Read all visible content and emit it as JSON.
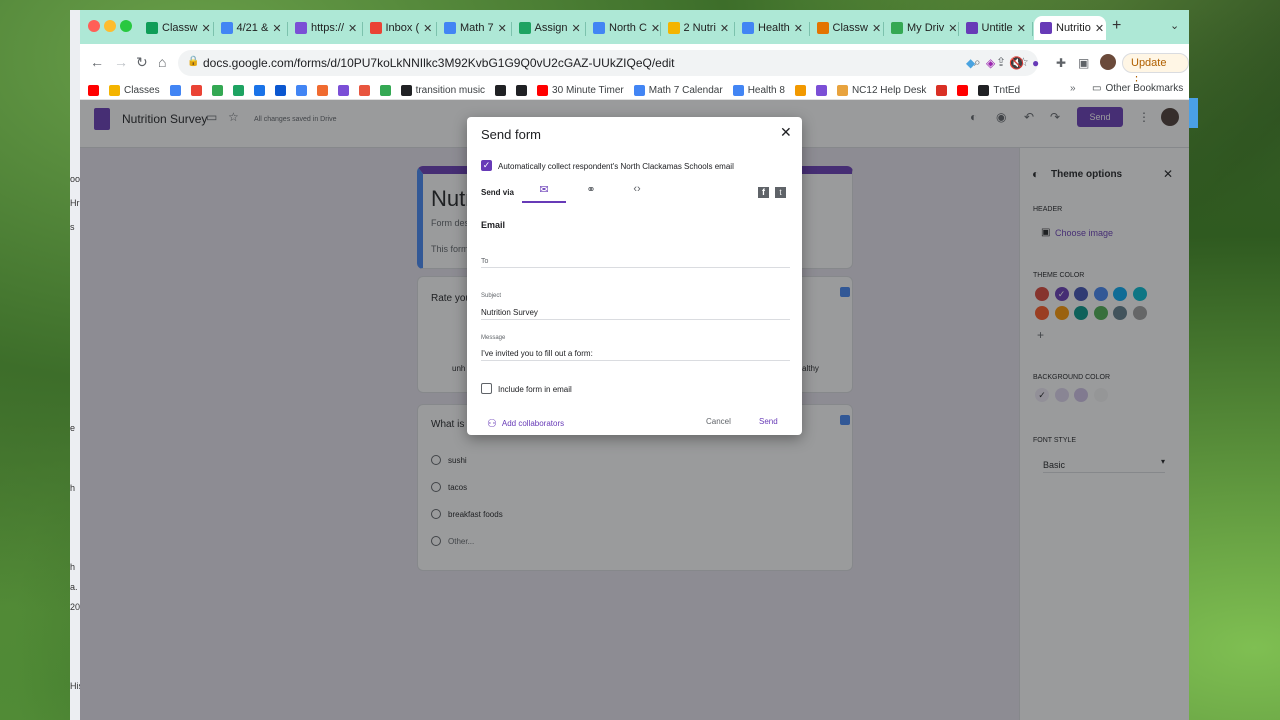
{
  "desktop": {
    "left_labels": [
      "oo",
      "Hr",
      "s",
      "e",
      "h",
      "h",
      "a.",
      "20",
      "His"
    ]
  },
  "tabs": [
    {
      "label": "Classw",
      "color": "#0f9d58"
    },
    {
      "label": "4/21 &",
      "color": "#4285f4"
    },
    {
      "label": "https://",
      "color": "#7b4fd6"
    },
    {
      "label": "Inbox (",
      "color": "#ea4335"
    },
    {
      "label": "Math 7",
      "color": "#4285f4"
    },
    {
      "label": "Assign",
      "color": "#1ea362"
    },
    {
      "label": "North C",
      "color": "#4285f4"
    },
    {
      "label": "2 Nutri",
      "color": "#f4b400"
    },
    {
      "label": "Health",
      "color": "#4285f4"
    },
    {
      "label": "Classw",
      "color": "#e37400"
    },
    {
      "label": "My Driv",
      "color": "#34a853"
    },
    {
      "label": "Untitle",
      "color": "#673ab7"
    },
    {
      "label": "Nutritio",
      "color": "#673ab7"
    }
  ],
  "address": {
    "url": "docs.google.com/forms/d/10PU7koLkNNIlkc3M92KvbG1G9Q0vU2cGAZ-UUkZIQeQ/edit"
  },
  "browser": {
    "update_label": "Update",
    "new_tab": "+",
    "menu": "⋮"
  },
  "bookmarks": [
    {
      "label": "",
      "color": "#ff0000"
    },
    {
      "label": "Classes",
      "color": "#f4b400"
    },
    {
      "label": "",
      "color": "#4285f4"
    },
    {
      "label": "",
      "color": "#ea4335"
    },
    {
      "label": "",
      "color": "#34a853"
    },
    {
      "label": "",
      "color": "#1ea362"
    },
    {
      "label": "",
      "color": "#1a73e8"
    },
    {
      "label": "",
      "color": "#0b57d0"
    },
    {
      "label": "",
      "color": "#4285f4"
    },
    {
      "label": "",
      "color": "#f06b30"
    },
    {
      "label": "",
      "color": "#7b4fd6"
    },
    {
      "label": "",
      "color": "#e8553e"
    },
    {
      "label": "",
      "color": "#34a853"
    },
    {
      "label": "transition music",
      "color": "#202124"
    },
    {
      "label": "",
      "color": "#202124"
    },
    {
      "label": "",
      "color": "#202124"
    },
    {
      "label": "30 Minute Timer",
      "color": "#ff0000"
    },
    {
      "label": "Math 7 Calendar",
      "color": "#4285f4"
    },
    {
      "label": "Health 8",
      "color": "#4285f4"
    },
    {
      "label": "",
      "color": "#f29900"
    },
    {
      "label": "",
      "color": "#7b4fd6"
    },
    {
      "label": "NC12 Help Desk",
      "color": "#e8a33e"
    },
    {
      "label": "",
      "color": "#d93025"
    },
    {
      "label": "",
      "color": "#ff0000"
    },
    {
      "label": "TntEd",
      "color": "#202124"
    }
  ],
  "bookmarks_more": "»",
  "bookmarks_other": "Other Bookmarks",
  "forms": {
    "title": "Nutrition Survey",
    "saved": "All changes saved in Drive",
    "send": "Send"
  },
  "form": {
    "title_partial": "Nutr",
    "desc_partial": "Form desc",
    "note_partial": "This form",
    "q1_partial": "Rate you",
    "q1_left": "unh",
    "q1_right": "althy",
    "q2_partial": "What is y",
    "options": [
      "sushi",
      "tacos",
      "breakfast foods",
      "Other..."
    ]
  },
  "theme": {
    "title": "Theme options",
    "header_label": "HEADER",
    "choose_image": "Choose image",
    "theme_color_label": "THEME COLOR",
    "theme_colors": [
      "#db4437",
      "#673ab7",
      "#3f51b5",
      "#4285f4",
      "#03a9f4",
      "#00bcd4",
      "#ff5722",
      "#ff9800",
      "#009688",
      "#4caf50",
      "#607d8b",
      "#9e9e9e"
    ],
    "add": "+",
    "bg_color_label": "BACKGROUND COLOR",
    "bg_colors": [
      "#f0ebf8",
      "#e1d8f1",
      "#d1c4e9",
      "#f6f6f6"
    ],
    "font_style_label": "FONT STYLE",
    "font_style": "Basic"
  },
  "dialog": {
    "title": "Send form",
    "collect_email": "Automatically collect respondent's North Clackamas Schools email",
    "send_via": "Send via",
    "section": "Email",
    "to_label": "To",
    "subject_label": "Subject",
    "subject_value": "Nutrition Survey",
    "message_label": "Message",
    "message_value": "I've invited you to fill out a form:",
    "include_form": "Include form in email",
    "add_collaborators": "Add collaborators",
    "cancel": "Cancel",
    "send": "Send"
  },
  "colors": {
    "accent": "#673ab7",
    "tabstrip": "#aee8d6",
    "overlay": "rgba(32,33,36,0.45)"
  }
}
